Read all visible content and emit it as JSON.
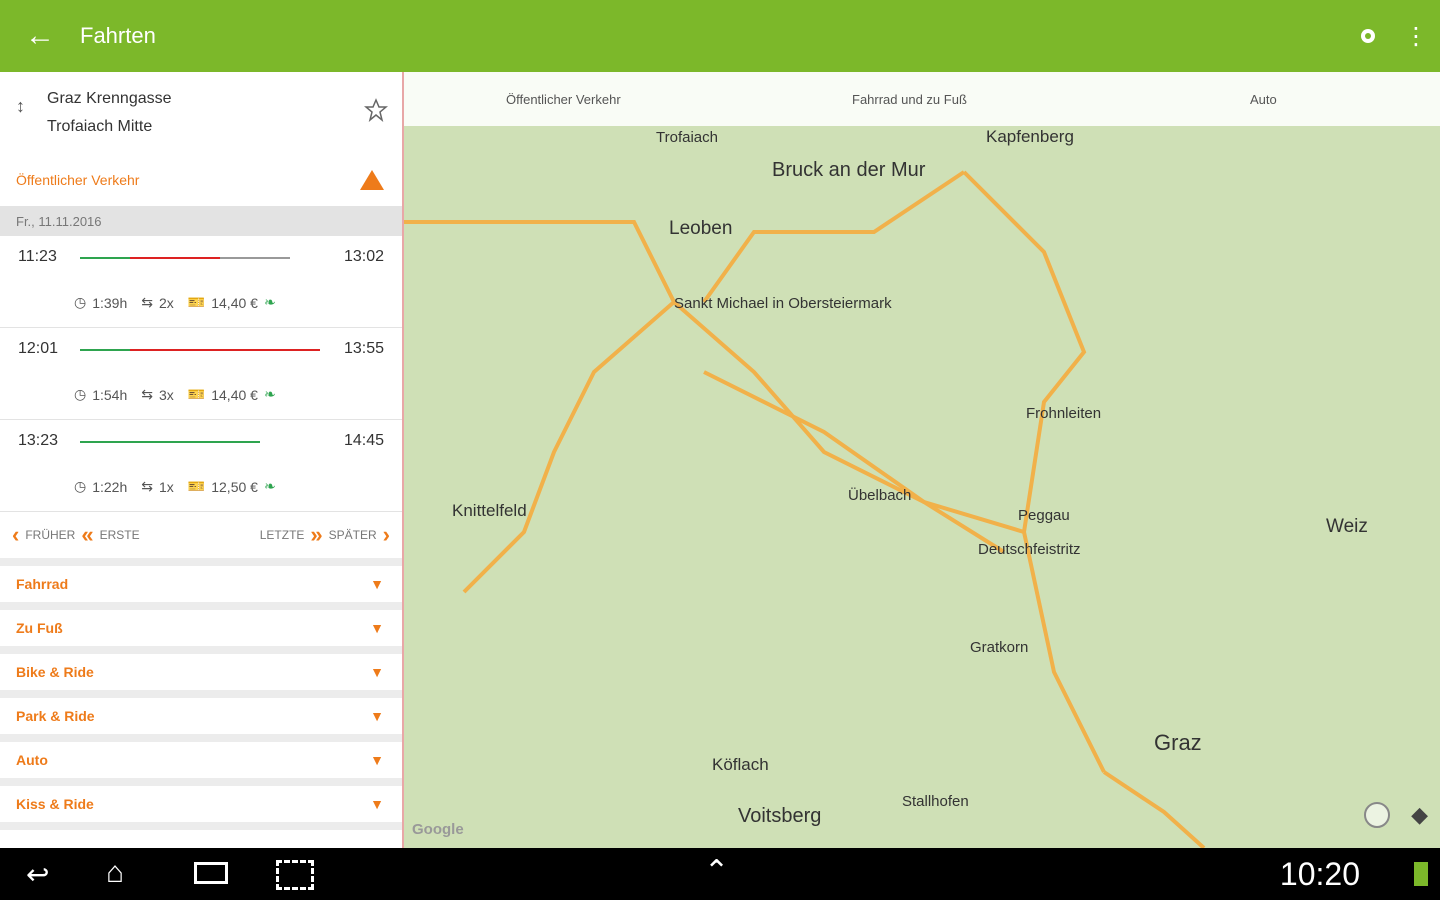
{
  "appbar": {
    "title": "Fahrten",
    "back_icon": "arrow-left-icon",
    "bg": "#7cb82a"
  },
  "route": {
    "from": "Graz Krenngasse",
    "to": "Trofaiach Mitte"
  },
  "transit": {
    "label": "Öffentlicher Verkehr",
    "date": "Fr., 11.11.2016"
  },
  "trips": [
    {
      "dep": "11:23",
      "arr": "13:02",
      "duration": "1:39h",
      "changes": "2x",
      "price": "14,40 €"
    },
    {
      "dep": "12:01",
      "arr": "13:55",
      "duration": "1:54h",
      "changes": "3x",
      "price": "14,40 €"
    },
    {
      "dep": "13:23",
      "arr": "14:45",
      "duration": "1:22h",
      "changes": "1x",
      "price": "12,50 €"
    }
  ],
  "pager": {
    "earlier": "FRÜHER",
    "first": "ERSTE",
    "last": "LETZTE",
    "later": "SPÄTER"
  },
  "modes": [
    "Fahrrad",
    "Zu Fuß",
    "Bike & Ride",
    "Park & Ride",
    "Auto",
    "Kiss & Ride"
  ],
  "map": {
    "tabs": [
      "Öffentlicher Verkehr",
      "Fahrrad und zu Fuß",
      "Auto"
    ],
    "places": [
      "Trofaiach",
      "Kapfenberg",
      "Bruck an der Mur",
      "Leoben",
      "Sankt Michael in Obersteiermark",
      "Frohnleiten",
      "Knittelfeld",
      "Übelbach",
      "Peggau",
      "Deutschfeistritz",
      "Weiz",
      "Gratkorn",
      "Graz",
      "Köflach",
      "Voitsberg",
      "Stallhofen"
    ],
    "attribution": "Google"
  },
  "status": {
    "time": "10:20"
  }
}
